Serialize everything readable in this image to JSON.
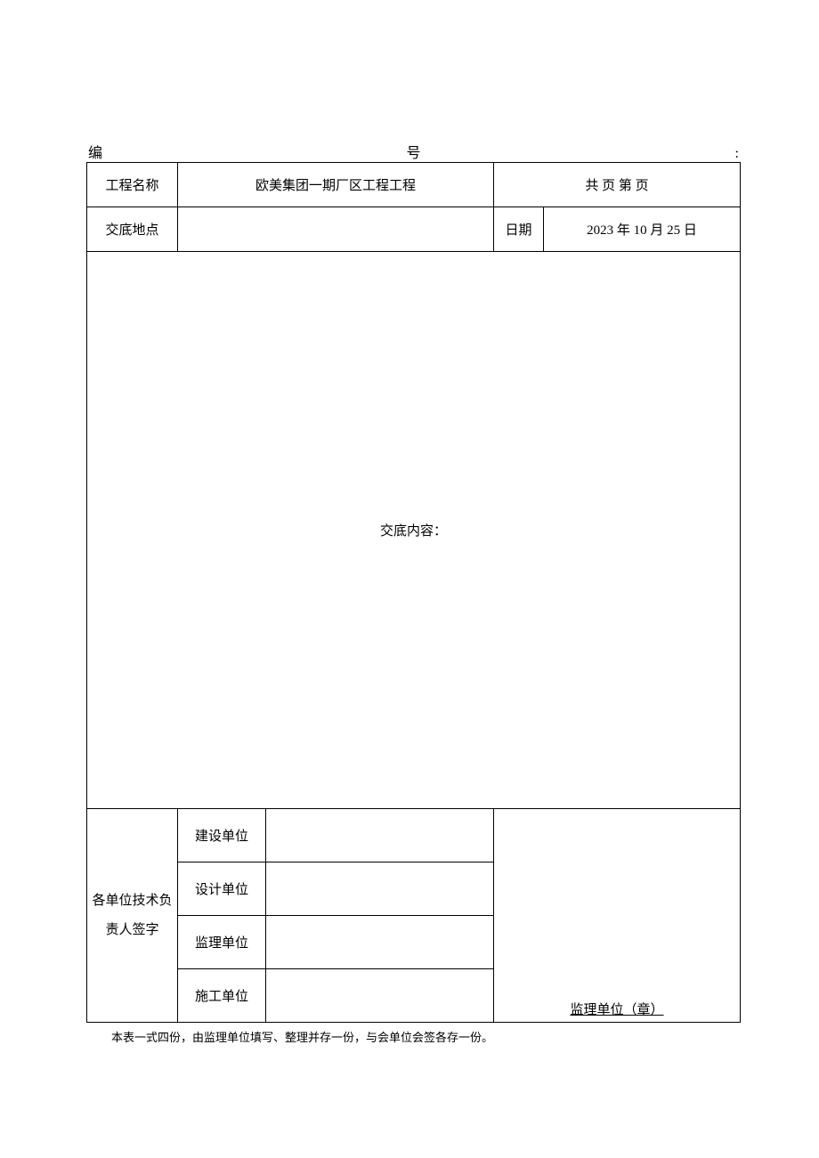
{
  "prefix": {
    "left": "编",
    "mid": "号",
    "right": ":"
  },
  "header": {
    "projectLabel": "工程名称",
    "projectValue": "欧美集团一期厂区工程工程",
    "pageInfo": "共 页 第 页",
    "locationLabel": "交底地点",
    "locationValue": "",
    "dateLabel": "日期",
    "dateValue": "2023 年 10 月 25 日"
  },
  "content": {
    "label": "交底内容：",
    "body": ""
  },
  "signature": {
    "groupLabel": "各单位技术负责人签字",
    "rows": {
      "construction": "建设单位",
      "design": "设计单位",
      "supervision": "监理单位",
      "contractor": "施工单位"
    },
    "stamp": "监理单位（章）"
  },
  "footer": "本表一式四份，由监理单位填写、整理并存一份，与会单位会签各存一份。"
}
